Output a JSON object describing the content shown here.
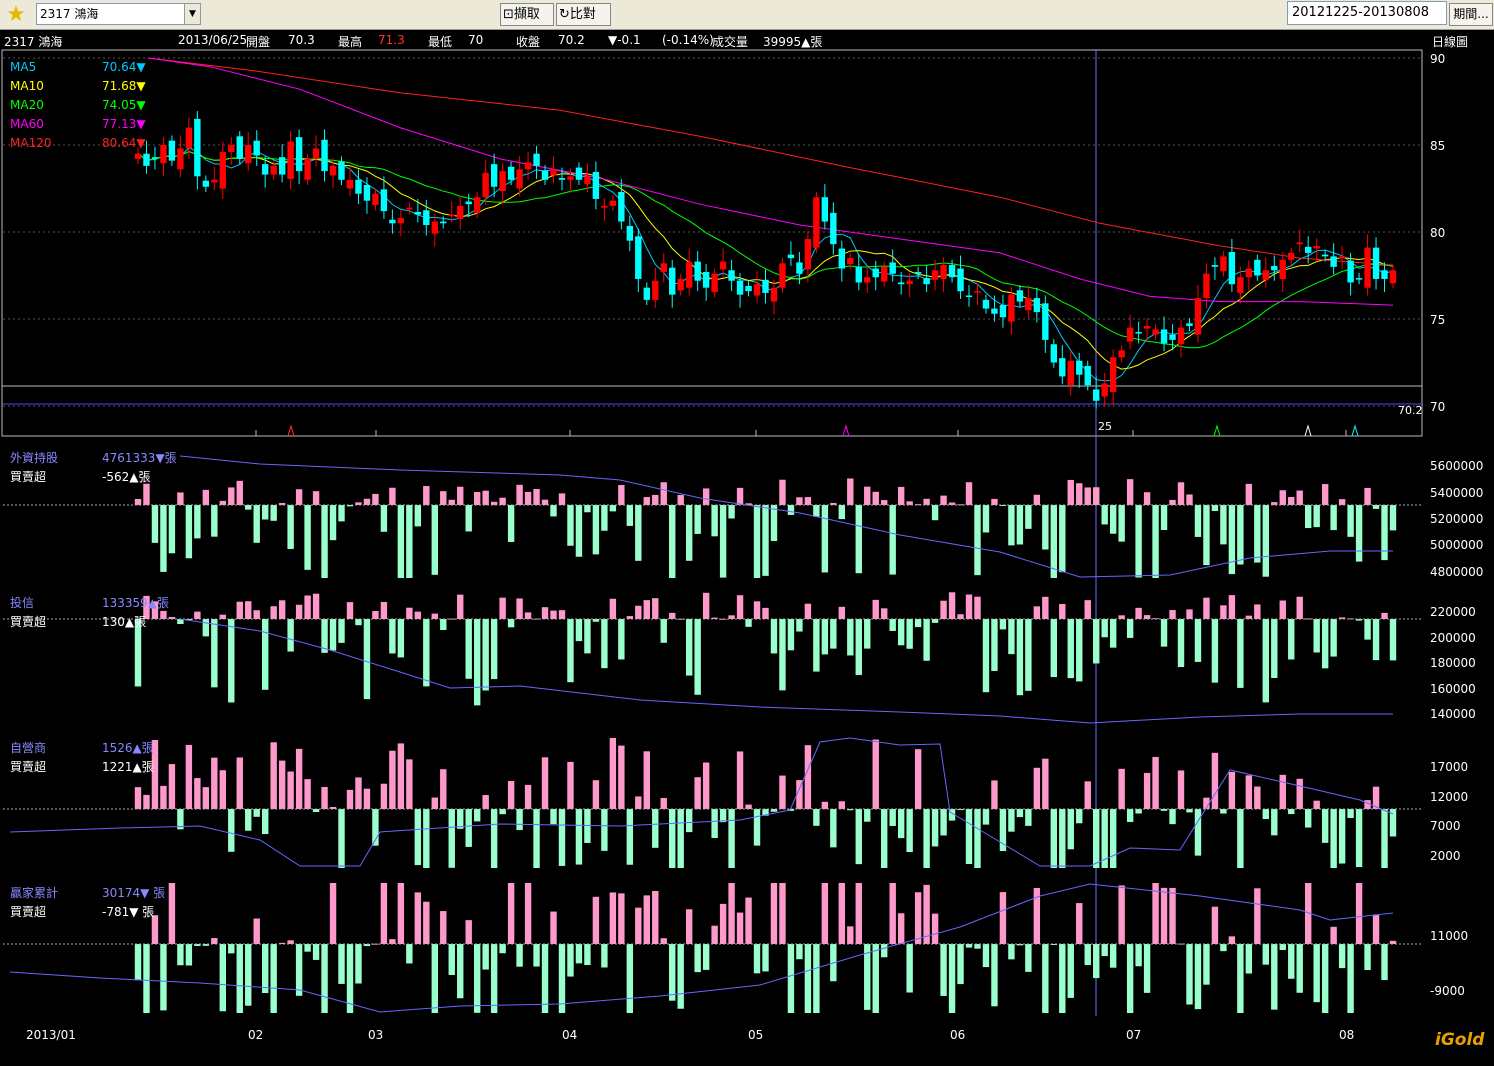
{
  "toolbar": {
    "stock_select": "2317 鴻海",
    "capture_label": "擷取",
    "compare_label": "比對",
    "date_range": "20121225-20130808",
    "period_label": "期間..."
  },
  "info": {
    "symbol": "2317 鴻海",
    "date": "2013/06/25",
    "open_label": "開盤",
    "open": "70.3",
    "high_label": "最高",
    "high": "71.3",
    "low_label": "最低",
    "low": "70",
    "close_label": "收盤",
    "close": "70.2",
    "change": "▼-0.1",
    "change_pct": "(-0.14%)",
    "volume_label": "成交量",
    "volume": "39995▲張",
    "chart_kind": "日線圖"
  },
  "ma_legend": [
    {
      "name": "MA5",
      "value": "70.64▼",
      "color": "#00c8ff"
    },
    {
      "name": "MA10",
      "value": "71.68▼",
      "color": "#ffff00"
    },
    {
      "name": "MA20",
      "value": "74.05▼",
      "color": "#00ff00"
    },
    {
      "name": "MA60",
      "value": "77.13▼",
      "color": "#ff00ff"
    },
    {
      "name": "MA120",
      "value": "80.64▼",
      "color": "#ff2020"
    }
  ],
  "panels": {
    "foreign": {
      "title": "外資持股",
      "holding": "4761333▼張",
      "net_label": "買賣超",
      "net": "-562▲張",
      "yticks": [
        "5600000",
        "5400000",
        "5200000",
        "5000000",
        "4800000"
      ]
    },
    "trust": {
      "title": "投信",
      "holding": "133359▲張",
      "net_label": "買賣超",
      "net": "130▲張",
      "yticks": [
        "220000",
        "200000",
        "180000",
        "160000",
        "140000"
      ]
    },
    "dealer": {
      "title": "自營商",
      "holding": "1526▲張",
      "net_label": "買賣超",
      "net": "1221▲張",
      "yticks": [
        "17000",
        "12000",
        "7000",
        "2000"
      ]
    },
    "winner": {
      "title": "贏家累計",
      "holding": "30174▼ 張",
      "net_label": "買賣超",
      "net": "-781▼ 張",
      "yticks": [
        "11000",
        "-9000"
      ]
    }
  },
  "price_axis": {
    "ticks": [
      "90",
      "85",
      "80",
      "75",
      "70"
    ],
    "last": "70.2",
    "cursor_day": "25"
  },
  "x_axis": [
    "2013/01",
    "02",
    "03",
    "04",
    "05",
    "06",
    "07",
    "08"
  ],
  "brand": "iGold",
  "colors": {
    "up": "#ff0000",
    "down": "#00ffff",
    "buy": "#ff99cc",
    "sell": "#99ffcc",
    "line": "#6666ff",
    "cursor": "#6a6aff"
  },
  "chart_data": {
    "type": "candlestick",
    "title": "2317 鴻海",
    "xlabel": "",
    "ylabel": "",
    "ylim": [
      70,
      90
    ],
    "closes": [
      84.5,
      83.8,
      84.2,
      85.0,
      84.1,
      84.8,
      86.0,
      83.2,
      82.6,
      83.0,
      84.6,
      85.0,
      84.2,
      85.0,
      84.4,
      83.3,
      83.8,
      83.3,
      85.2,
      83.5,
      84.2,
      84.8,
      83.5,
      83.8,
      83.0,
      83.0,
      82.2,
      81.8,
      82.2,
      81.2,
      80.5,
      80.8,
      81.4,
      81.0,
      80.4,
      80.6,
      80.5,
      81.0,
      81.5,
      81.6,
      82.0,
      83.4,
      82.6,
      83.5,
      83.0,
      83.6,
      84.0,
      83.8,
      83.0,
      83.6,
      83.0,
      83.2,
      83.0,
      83.2,
      81.9,
      81.5,
      81.8,
      80.6,
      79.5,
      77.3,
      76.1,
      77.2,
      78.2,
      76.4,
      77.3,
      78.3,
      77.2,
      76.8,
      77.6,
      78.3,
      77.2,
      76.4,
      76.6,
      77.0,
      76.5,
      76.8,
      78.2,
      78.5,
      77.6,
      79.6,
      82.0,
      80.6,
      79.3,
      77.9,
      78.5,
      77.1,
      77.4,
      77.4,
      78.0,
      77.6,
      77.0,
      77.2,
      77.6,
      77.0,
      77.8,
      78.1,
      77.4,
      76.6,
      76.3,
      76.6,
      75.6,
      75.3,
      75.1,
      76.4,
      76.0,
      76.2,
      75.4,
      73.8,
      72.5,
      71.7,
      72.6,
      71.8,
      71.2,
      70.3,
      71.3,
      72.8,
      73.2,
      74.5,
      74.2,
      74.6,
      74.4,
      73.6,
      73.8,
      74.5,
      74.6,
      76.2,
      77.6,
      78.0,
      78.6,
      77.0,
      77.4,
      77.9,
      77.5,
      77.8,
      77.8,
      78.4,
      78.8,
      79.4,
      78.8,
      79.2,
      78.6,
      78.0,
      78.6,
      77.1,
      77.3,
      79.1,
      77.3,
      77.3,
      77.8
    ],
    "ma": {
      "MA5": 70.64,
      "MA10": 71.68,
      "MA20": 74.05,
      "MA60": 77.13,
      "MA120": 80.64
    }
  }
}
